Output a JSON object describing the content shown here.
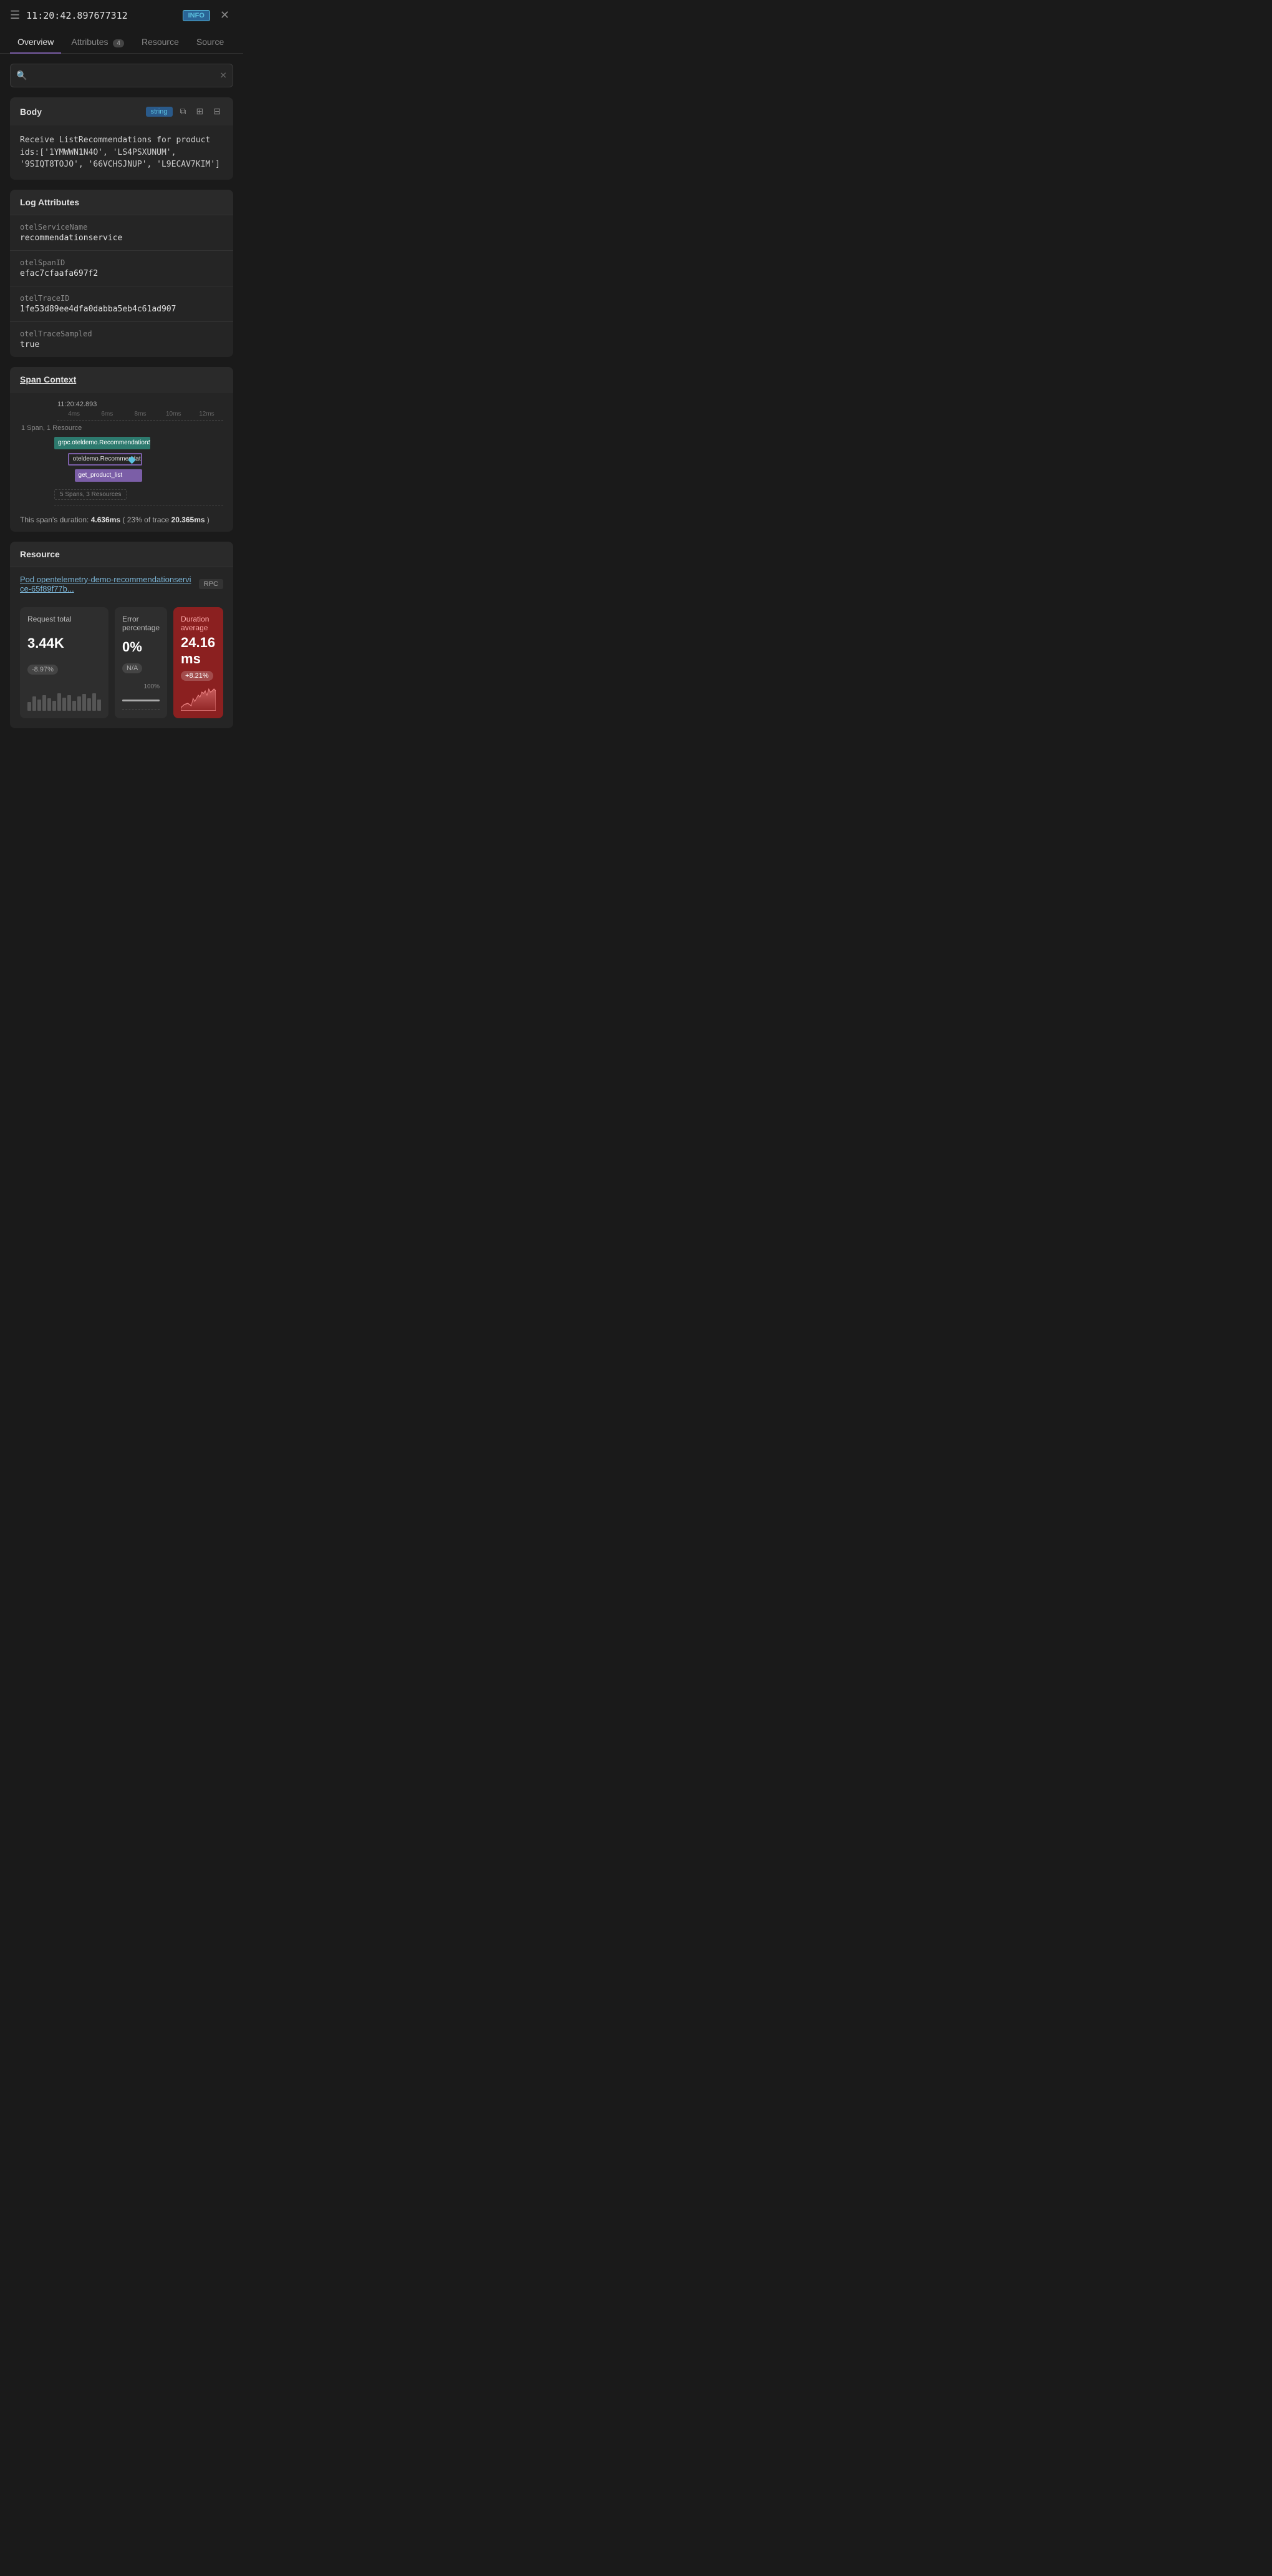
{
  "header": {
    "timestamp": "11:20:42.897677312",
    "badge": "INFO",
    "icon": "☰",
    "close": "✕"
  },
  "tabs": [
    {
      "label": "Overview",
      "active": true,
      "badge": null
    },
    {
      "label": "Attributes",
      "active": false,
      "badge": "4"
    },
    {
      "label": "Resource",
      "active": false,
      "badge": null
    },
    {
      "label": "Source",
      "active": false,
      "badge": null
    }
  ],
  "search": {
    "placeholder": "",
    "clear_icon": "✕"
  },
  "body": {
    "title": "Body",
    "type_badge": "string",
    "text": "Receive ListRecommendations for product ids:['1YMWWN1N4O', 'LS4PSXUNUM', '9SIQT8TOJO', '66VCHSJNUP', 'L9ECAV7KIM']"
  },
  "log_attributes": {
    "title": "Log Attributes",
    "items": [
      {
        "key": "otelServiceName",
        "value": "recommendationservice"
      },
      {
        "key": "otelSpanID",
        "value": "efac7cfaafa697f2"
      },
      {
        "key": "otelTraceID",
        "value": "1fe53d89ee4dfa0dabba5eb4c61ad907"
      },
      {
        "key": "otelTraceSampled",
        "value": "true"
      }
    ]
  },
  "span_context": {
    "title": "Span Context",
    "time_label": "11:20:42.893",
    "axis_labels": [
      "4ms",
      "6ms",
      "8ms",
      "10ms",
      "12ms"
    ],
    "span_info": "1 Span, 1 Resource",
    "bars": [
      {
        "label": "",
        "text": "grpc.oteldemo.RecommendationServic",
        "style": "teal",
        "left": "0%",
        "width": "55%"
      },
      {
        "label": "",
        "text": "oteldemo.RecommendationSe",
        "style": "purple-outline",
        "left": "8%",
        "width": "42%",
        "has_diamond": true
      },
      {
        "label": "",
        "text": "get_product_list",
        "style": "purple",
        "left": "12%",
        "width": "38%"
      }
    ],
    "sub_info": "5 Spans, 3 Resources",
    "duration_text": "This span's duration:",
    "duration_value": "4.636ms",
    "duration_pct": "23%",
    "duration_of": "of trace",
    "trace_duration": "20.365ms"
  },
  "resource": {
    "title": "Resource",
    "link": "Pod opentelemetry-demo-recommendationservice-65f89f77b....",
    "rpc_badge": "RPC"
  },
  "metrics": [
    {
      "title": "Request total",
      "value": "3.44K",
      "delta": "-8.97%",
      "type": "bars",
      "bar_heights": [
        30,
        50,
        40,
        60,
        55,
        45,
        70,
        50,
        60,
        40,
        55,
        65,
        50,
        70,
        45
      ]
    },
    {
      "title": "Error percentage",
      "value": "0%",
      "delta": "N/A",
      "pct_label": "100%",
      "type": "progress"
    },
    {
      "title": "Duration average",
      "value": "24.16 ms",
      "delta": "+8.21%",
      "type": "area",
      "color": "red"
    }
  ]
}
